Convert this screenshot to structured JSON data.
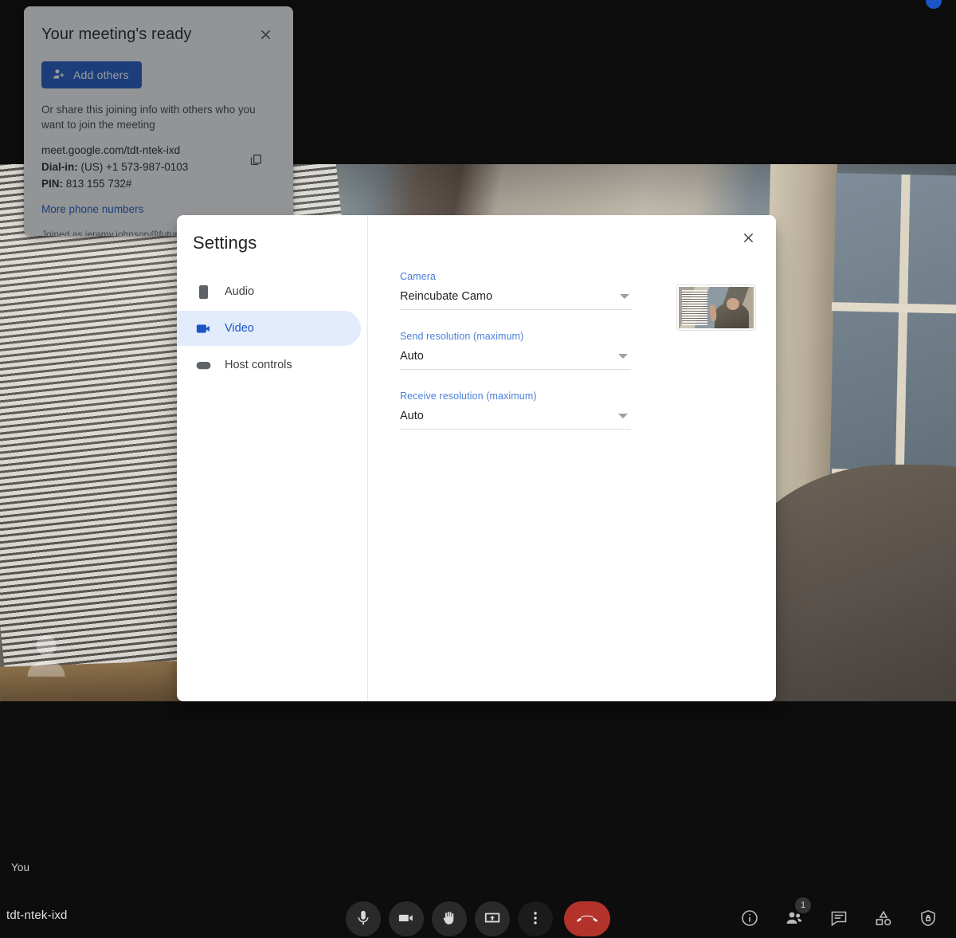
{
  "stage": {
    "self_label": "You",
    "meeting_code": "tdt-ntek-ixd"
  },
  "meeting_panel": {
    "title": "Your meeting's ready",
    "close_icon": "close-icon",
    "add_others_label": "Add others",
    "add_others_icon": "person-add-icon",
    "share_text": "Or share this joining info with others who you want to join the meeting",
    "meet_link": "meet.google.com/tdt-ntek-ixd",
    "dial_in_label": "Dial-in:",
    "dial_in_number": "(US) +1 573-987-0103",
    "pin_label": "PIN:",
    "pin_value": "813 155 732#",
    "copy_icon": "copy-icon",
    "more_numbers_label": "More phone numbers",
    "joined_as": "Joined as jeramy.johnson@futurenet.com"
  },
  "settings": {
    "title": "Settings",
    "close_icon": "close-icon",
    "nav": [
      {
        "label": "Audio",
        "icon": "speaker-icon",
        "active": false
      },
      {
        "label": "Video",
        "icon": "videocam-icon",
        "active": true
      },
      {
        "label": "Host controls",
        "icon": "toggle-switch-icon",
        "active": false
      }
    ],
    "fields": [
      {
        "label": "Camera",
        "value": "Reincubate Camo"
      },
      {
        "label": "Send resolution (maximum)",
        "value": "Auto"
      },
      {
        "label": "Receive resolution (maximum)",
        "value": "Auto"
      }
    ],
    "preview_name": "camera-preview"
  },
  "toolbar": {
    "center": [
      {
        "name": "microphone-button",
        "icon": "microphone-icon"
      },
      {
        "name": "camera-button",
        "icon": "videocam-icon"
      },
      {
        "name": "raise-hand-button",
        "icon": "hand-icon"
      },
      {
        "name": "present-screen-button",
        "icon": "present-screen-icon"
      },
      {
        "name": "more-options-button",
        "icon": "more-vert-icon"
      },
      {
        "name": "end-call-button",
        "icon": "call-end-icon"
      }
    ],
    "right": [
      {
        "name": "meeting-details-button",
        "icon": "info-icon",
        "badge": ""
      },
      {
        "name": "people-button",
        "icon": "people-icon",
        "badge": "1"
      },
      {
        "name": "chat-button",
        "icon": "chat-icon",
        "badge": ""
      },
      {
        "name": "activities-button",
        "icon": "activities-icon",
        "badge": ""
      },
      {
        "name": "host-controls-button",
        "icon": "shield-lock-icon",
        "badge": ""
      }
    ]
  },
  "colors": {
    "accent_blue": "#1a56c4",
    "label_blue": "#4a7fdc",
    "nav_active_bg": "#e3ecfd",
    "hangup_red": "#b3332b",
    "panel_bg": "#f1f3f4"
  }
}
